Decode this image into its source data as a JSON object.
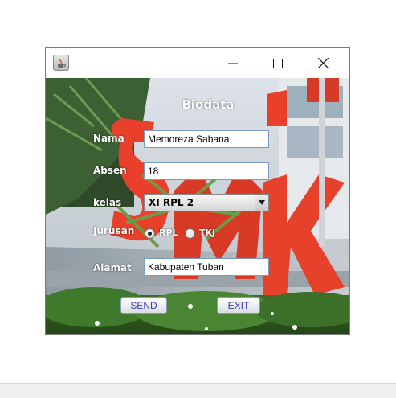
{
  "window": {
    "controls": {
      "minimize": "─",
      "maximize": "☐",
      "close": "✕"
    }
  },
  "form": {
    "title": "Biodata",
    "nama": {
      "label": "Nama",
      "value": "Memoreza Sabana"
    },
    "absen": {
      "label": "Absen",
      "value": "18"
    },
    "kelas": {
      "label": "kelas",
      "selected": "XI RPL 2"
    },
    "jurusan": {
      "label": "Jurusan",
      "options": [
        {
          "label": "RPL",
          "checked": true
        },
        {
          "label": "TKJ",
          "checked": false
        }
      ]
    },
    "alamat": {
      "label": "Alamat",
      "value": "Kabupaten Tuban"
    },
    "buttons": {
      "send": "SEND",
      "exit": "EXIT"
    }
  },
  "colors": {
    "accent_text": "#3a3aa8",
    "sign_red": "#e8402a"
  }
}
